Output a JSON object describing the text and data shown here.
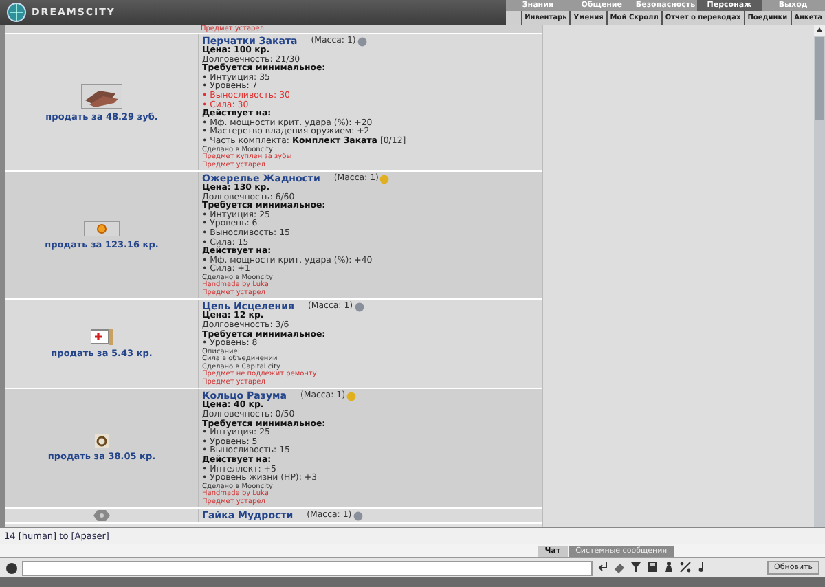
{
  "header": {
    "logo": "DREAMSCITY",
    "menu": [
      {
        "label": "Знания",
        "selected": false
      },
      {
        "label": "Общение",
        "selected": false
      },
      {
        "label": "Безопасность",
        "selected": false
      },
      {
        "label": "Персонаж",
        "selected": true
      },
      {
        "label": "Выход",
        "selected": false
      }
    ],
    "submenu": [
      "Инвентарь",
      "Умения",
      "Мой Скролл",
      "Отчет о переводах",
      "Поединки",
      "Анкета"
    ]
  },
  "top_fragment": "Предмет устарел",
  "items": [
    {
      "kind": "gloves",
      "sell": "продать за 48.29 зуб.",
      "name": "Перчатки Заката",
      "mass": {
        "text": "(Масса: 1)",
        "color": "#8a8f9c"
      },
      "price": "Цена: 100 кр.",
      "durability": "Долговечность: 21/30",
      "requires_title": "Требуется минимальное:",
      "requires": [
        {
          "text": "• Интуиция: 35",
          "unmet": false
        },
        {
          "text": "• Уровень: 7",
          "unmet": false
        },
        {
          "text": "• Выносливость: 30",
          "unmet": true
        },
        {
          "text": "• Сила: 30",
          "unmet": true
        }
      ],
      "effects_title": "Действует на:",
      "effects": [
        "• Мф. мощности крит. удара (%): +20",
        "• Мастерство владения оружием: +2",
        "• Часть комплекта: **Комплект Заката** [0/12]"
      ],
      "notes": [
        {
          "text": "Сделано в Mooncity",
          "kind": "plain"
        },
        {
          "text": "Предмет куплен за зубы",
          "kind": "warning"
        },
        {
          "text": "Предмет устарел",
          "kind": "warning"
        }
      ]
    },
    {
      "kind": "amulet",
      "sell": "продать за 123.16 кр.",
      "name": "Ожерелье Жадности",
      "mass": {
        "text": "(Масса: 1)",
        "color": "#e0b020"
      },
      "price": "Цена: 130 кр.",
      "durability": "Долговечность: 6/60",
      "requires_title": "Требуется минимальное:",
      "requires": [
        {
          "text": "• Интуиция: 25",
          "unmet": false
        },
        {
          "text": "• Уровень: 6",
          "unmet": false
        },
        {
          "text": "• Выносливость: 15",
          "unmet": false
        },
        {
          "text": "• Сила: 15",
          "unmet": false
        }
      ],
      "effects_title": "Действует на:",
      "effects": [
        "• Мф. мощности крит. удара (%): +40",
        "• Сила: +1"
      ],
      "notes": [
        {
          "text": "Сделано в Mooncity",
          "kind": "plain"
        },
        {
          "text": "Handmade by Luka",
          "kind": "warning"
        },
        {
          "text": "Предмет устарел",
          "kind": "warning"
        }
      ]
    },
    {
      "kind": "scroll",
      "sell": "продать за 5.43 кр.",
      "name": "Цепь Исцеления",
      "mass": {
        "text": "(Масса: 1)",
        "color": "#8a8f9c"
      },
      "price": "Цена: 12 кр.",
      "durability": "Долговечность: 3/6",
      "requires_title": "Требуется минимальное:",
      "requires": [
        {
          "text": "• Уровень: 8",
          "unmet": false
        }
      ],
      "notes": [
        {
          "text": "Описание:",
          "kind": "plain"
        },
        {
          "text": "Сила в объединении",
          "kind": "plain"
        },
        {
          "text": "Сделано в Capital city",
          "kind": "plain"
        },
        {
          "text": "Предмет не подлежит ремонту",
          "kind": "warning"
        },
        {
          "text": "Предмет устарел",
          "kind": "warning"
        }
      ]
    },
    {
      "kind": "ring",
      "sell": "продать за 38.05 кр.",
      "name": "Кольцо Разума",
      "mass": {
        "text": "(Масса: 1)",
        "color": "#e0b020"
      },
      "price": "Цена: 40 кр.",
      "durability": "Долговечность: 0/50",
      "requires_title": "Требуется минимальное:",
      "requires": [
        {
          "text": "• Интуиция: 25",
          "unmet": false
        },
        {
          "text": "• Уровень: 5",
          "unmet": false
        },
        {
          "text": "• Выносливость: 15",
          "unmet": false
        }
      ],
      "effects_title": "Действует на:",
      "effects": [
        "• Интеллект: +5",
        "• Уровень жизни (HP): +3"
      ],
      "notes": [
        {
          "text": "Сделано в Moonсity",
          "kind": "plain"
        },
        {
          "text": "Handmade by Luka",
          "kind": "warning"
        },
        {
          "text": "Предмет устарел",
          "kind": "warning"
        }
      ]
    },
    {
      "kind": "nut",
      "name": "Гайка Мудрости",
      "mass": {
        "text": "(Масса: 1)",
        "color": "#8a8f9c"
      }
    }
  ],
  "chat": {
    "message": "14 [human] to [Apaser]",
    "tabs": [
      {
        "label": "Чат",
        "selected": true
      },
      {
        "label": "Системные сообщения",
        "selected": false
      }
    ],
    "refresh": "Обновить"
  }
}
